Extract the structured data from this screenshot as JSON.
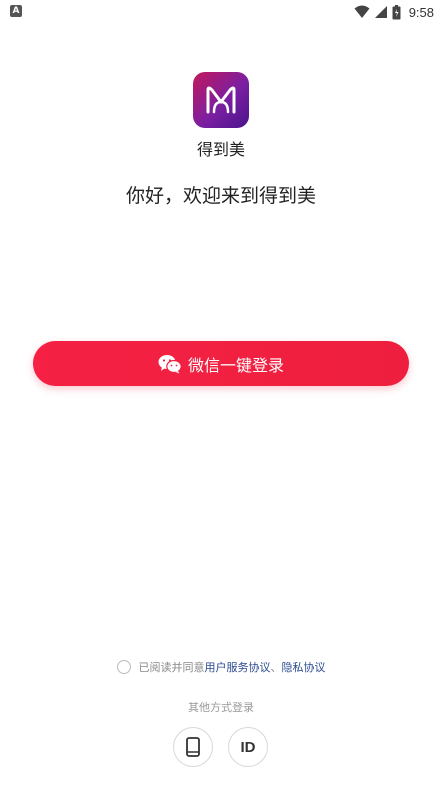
{
  "status_bar": {
    "time": "9:58",
    "notification_letter": "A",
    "icons": [
      "wifi-icon",
      "signal-icon",
      "battery-icon"
    ]
  },
  "app": {
    "name": "得到美",
    "icon": "app-logo-icon",
    "accent_color": "#f0203f"
  },
  "welcome": {
    "text": "你好，欢迎来到得到美"
  },
  "wechat_login": {
    "label": "微信一键登录",
    "icon": "wechat-icon"
  },
  "agreement": {
    "prefix": "已阅读并同意",
    "user_agreement": "用户服务协议",
    "separator": "、",
    "privacy": "隐私协议",
    "checked": false
  },
  "other_login": {
    "title": "其他方式登录",
    "options": [
      {
        "icon": "phone-icon"
      },
      {
        "label": "ID"
      }
    ]
  }
}
